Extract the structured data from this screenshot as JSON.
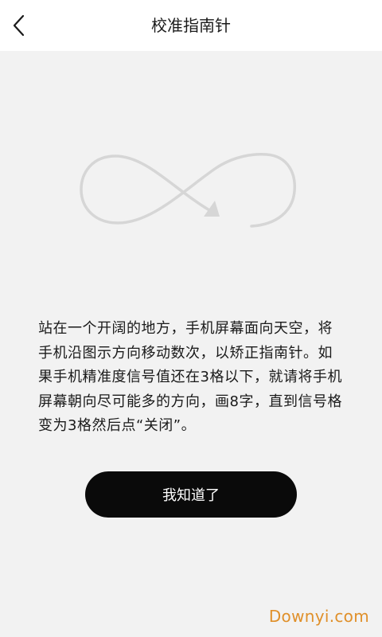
{
  "header": {
    "title": "校准指南针"
  },
  "main": {
    "instructions": "站在一个开阔的地方，手机屏幕面向天空，将\n手机沿图示方向移动数次，以矫正指南针。如\n果手机精准度信号值还在3格以下，就请将手机\n屏幕朝向尽可能多的方向，画8字，直到信号格\n变为3格然后点“关闭”。",
    "confirm_label": "我知道了"
  },
  "watermark": {
    "text": "Downyi.com"
  },
  "colors": {
    "background": "#f2f2f2",
    "header_bg": "#ffffff",
    "button_bg": "#0a0a0a",
    "illustration_stroke": "#d6d6d6",
    "watermark": "#e0902a"
  },
  "icons": {
    "back": "chevron-left-icon",
    "illustration": "figure-eight-arrow-icon"
  }
}
